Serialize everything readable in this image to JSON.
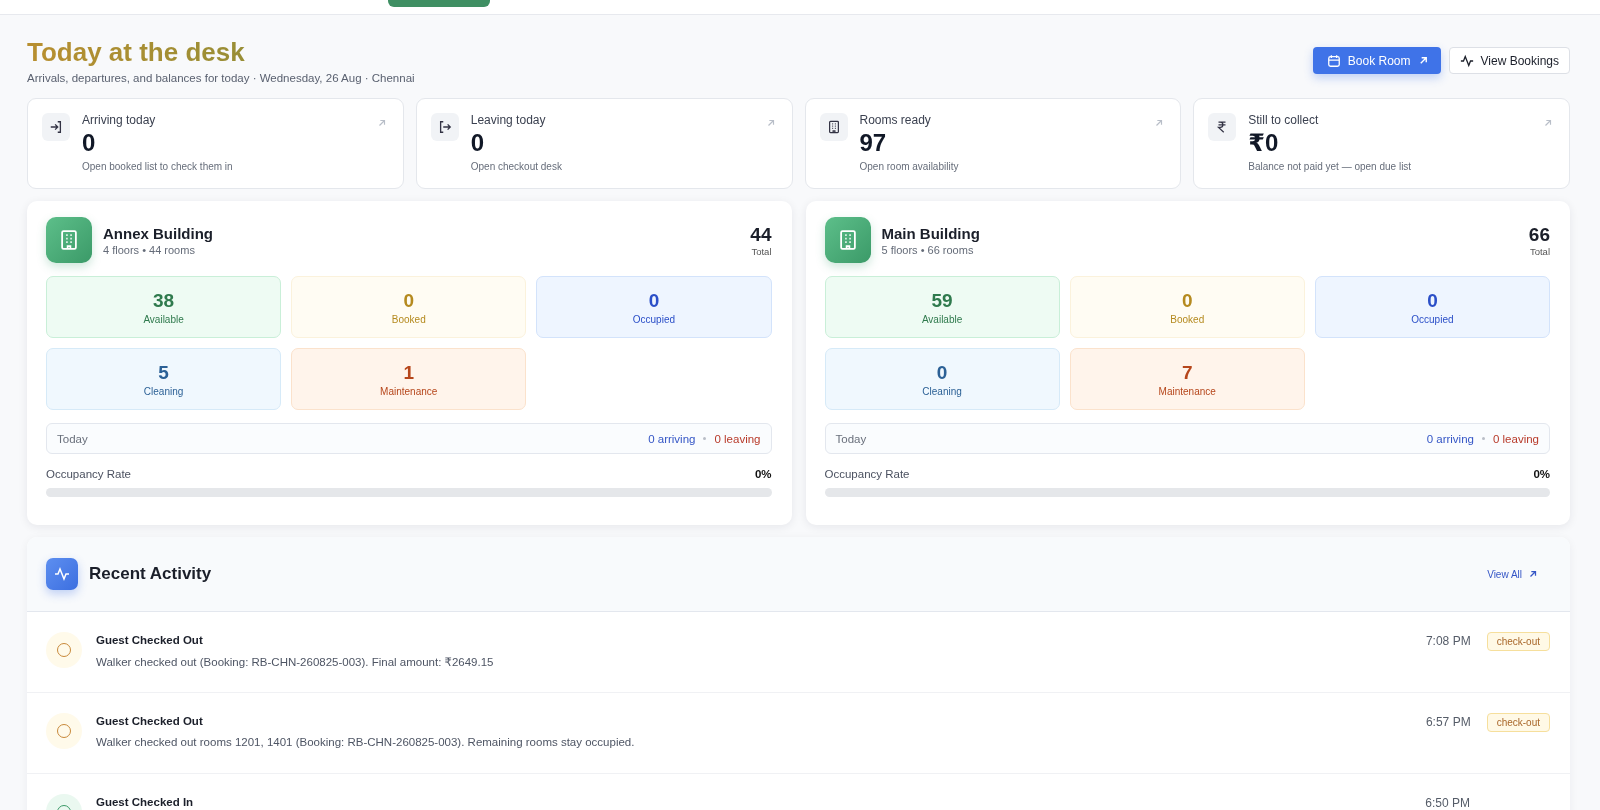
{
  "header": {
    "title": "Today at the desk",
    "subtitle": "Arrivals, departures, and balances for today · Wednesday, 26 Aug · Chennai",
    "buttons": [
      {
        "label": "Book Room",
        "kind": "primary"
      },
      {
        "label": "View Bookings",
        "kind": "secondary"
      }
    ]
  },
  "stat_cards": [
    {
      "kind": "arrive",
      "label": "Arriving today",
      "value": "0",
      "hint": "Open booked list to check them in"
    },
    {
      "kind": "leave",
      "label": "Leaving today",
      "value": "0",
      "hint": "Open checkout desk"
    },
    {
      "kind": "rooms",
      "label": "Rooms ready",
      "value": "97",
      "hint": "Open room availability"
    },
    {
      "kind": "money",
      "label": "Still to collect",
      "value": "₹0",
      "hint": "Balance not paid yet — open due list"
    }
  ],
  "buildings": [
    {
      "name": "Annex Building",
      "meta": "4 floors • 44 rooms",
      "total": "44",
      "total_label": "Total",
      "tiles": [
        {
          "kind": "available",
          "value": "38",
          "label": "Available"
        },
        {
          "kind": "booked",
          "value": "0",
          "label": "Booked"
        },
        {
          "kind": "occupied",
          "value": "0",
          "label": "Occupied"
        },
        {
          "kind": "cleaning",
          "value": "5",
          "label": "Cleaning"
        },
        {
          "kind": "maintenance",
          "value": "1",
          "label": "Maintenance"
        }
      ],
      "today": {
        "label": "Today",
        "arriving": "0 arriving",
        "leaving": "0 leaving"
      },
      "occupancy": {
        "label": "Occupancy Rate",
        "reading": "0%",
        "level": 0
      }
    },
    {
      "name": "Main Building",
      "meta": "5 floors • 66 rooms",
      "total": "66",
      "total_label": "Total",
      "tiles": [
        {
          "kind": "available",
          "value": "59",
          "label": "Available"
        },
        {
          "kind": "booked",
          "value": "0",
          "label": "Booked"
        },
        {
          "kind": "occupied",
          "value": "0",
          "label": "Occupied"
        },
        {
          "kind": "cleaning",
          "value": "0",
          "label": "Cleaning"
        },
        {
          "kind": "maintenance",
          "value": "7",
          "label": "Maintenance"
        }
      ],
      "today": {
        "label": "Today",
        "arriving": "0 arriving",
        "leaving": "0 leaving"
      },
      "occupancy": {
        "label": "Occupancy Rate",
        "reading": "0%",
        "level": 0
      }
    }
  ],
  "activity": {
    "title": "Recent Activity",
    "link": "View All",
    "items": [
      {
        "kind": "checkout",
        "title": "Guest Checked Out",
        "text": "Walker checked out (Booking: RB-CHN-260825-003). Final amount: ₹2649.15",
        "time": "7:08 PM",
        "tag": "check-out"
      },
      {
        "kind": "checkout",
        "title": "Guest Checked Out",
        "text": "Walker checked out rooms 1201, 1401 (Booking: RB-CHN-260825-003). Remaining rooms stay occupied.",
        "time": "6:57 PM",
        "tag": "check-out"
      },
      {
        "kind": "checkin",
        "title": "Guest Checked In",
        "time": "6:50 PM"
      }
    ]
  }
}
